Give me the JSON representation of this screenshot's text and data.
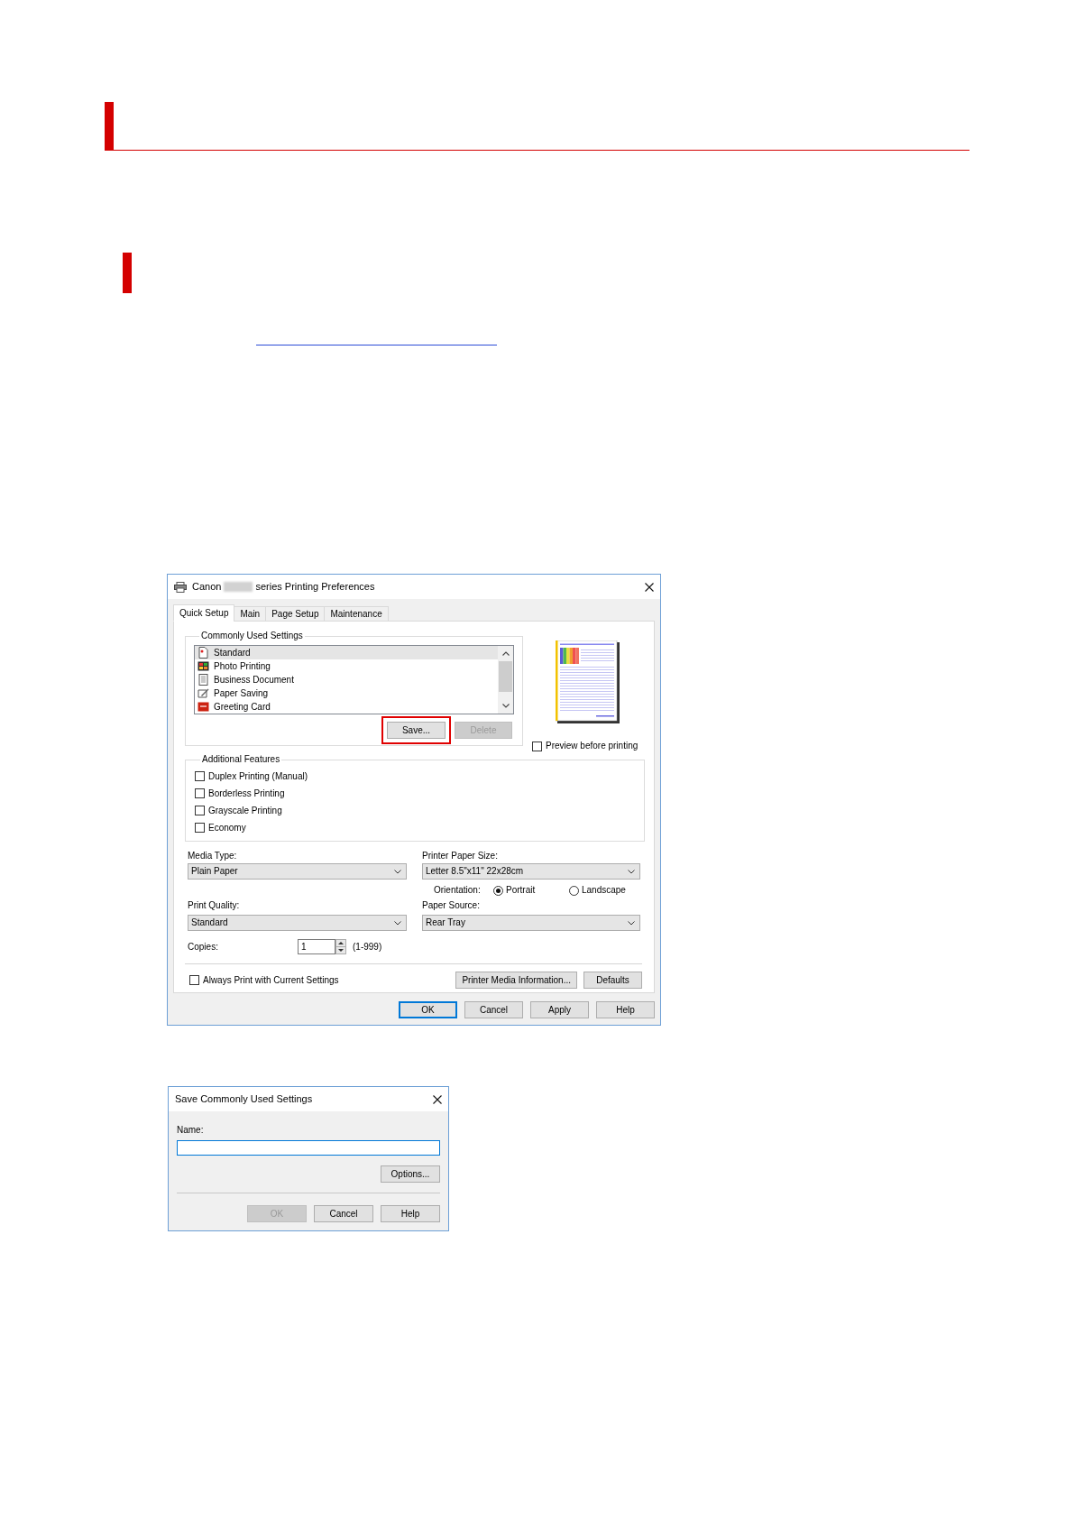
{
  "preferences_dialog": {
    "title": {
      "prefix": "Canon",
      "suffix": "series Printing Preferences"
    },
    "tabs": [
      {
        "label": "Quick Setup",
        "selected": true
      },
      {
        "label": "Main",
        "selected": false
      },
      {
        "label": "Page Setup",
        "selected": false
      },
      {
        "label": "Maintenance",
        "selected": false
      }
    ],
    "commonly_used_settings": {
      "label": "Commonly Used Settings",
      "items": [
        {
          "label": "Standard",
          "selected": true
        },
        {
          "label": "Photo Printing",
          "selected": false
        },
        {
          "label": "Business Document",
          "selected": false
        },
        {
          "label": "Paper Saving",
          "selected": false
        },
        {
          "label": "Greeting Card",
          "selected": false
        }
      ],
      "buttons": [
        {
          "label": "Save...",
          "disabled": false,
          "highlighted": true
        },
        {
          "label": "Delete",
          "disabled": true,
          "highlighted": false
        }
      ]
    },
    "preview_checkbox": {
      "label": "Preview before printing",
      "checked": false
    },
    "additional_features": {
      "label": "Additional Features",
      "options": [
        {
          "label": "Duplex Printing (Manual)",
          "checked": false
        },
        {
          "label": "Borderless Printing",
          "checked": false
        },
        {
          "label": "Grayscale Printing",
          "checked": false
        },
        {
          "label": "Economy",
          "checked": false
        }
      ]
    },
    "media_type": {
      "label": "Media Type:",
      "value": "Plain Paper"
    },
    "printer_paper_size": {
      "label": "Printer Paper Size:",
      "value": "Letter 8.5\"x11\" 22x28cm"
    },
    "orientation": {
      "label": "Orientation:",
      "options": [
        {
          "label": "Portrait",
          "selected": true
        },
        {
          "label": "Landscape",
          "selected": false
        }
      ]
    },
    "print_quality": {
      "label": "Print Quality:",
      "value": "Standard"
    },
    "paper_source": {
      "label": "Paper Source:",
      "value": "Rear Tray"
    },
    "copies": {
      "label": "Copies:",
      "value": "1",
      "range": "(1-999)"
    },
    "always_print_checkbox": {
      "label": "Always Print with Current Settings",
      "checked": false
    },
    "panel_buttons": [
      {
        "label": "Printer Media Information..."
      },
      {
        "label": "Defaults"
      }
    ],
    "buttons": [
      {
        "label": "OK",
        "focused": true
      },
      {
        "label": "Cancel",
        "focused": false
      },
      {
        "label": "Apply",
        "focused": false
      },
      {
        "label": "Help",
        "focused": false
      }
    ]
  },
  "save_dialog": {
    "title": "Save Commonly Used Settings",
    "name_label": "Name:",
    "name_field": {
      "focused": true
    },
    "options_button": "Options...",
    "buttons": [
      {
        "label": "OK",
        "disabled": true
      },
      {
        "label": "Cancel",
        "disabled": false
      },
      {
        "label": "Help",
        "disabled": false
      }
    ]
  }
}
